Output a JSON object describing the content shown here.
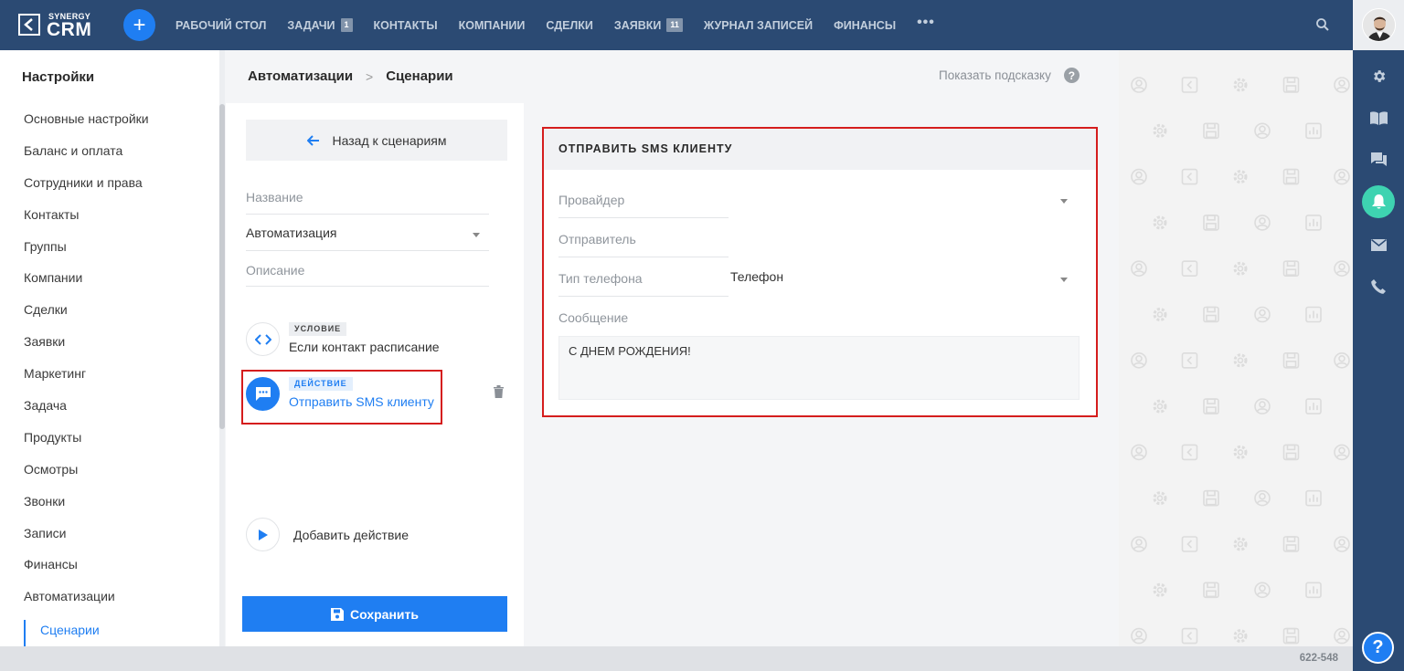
{
  "brand": {
    "logo_top": "SYNERGY",
    "logo_bottom": "CRM",
    "accent": "#1f7ef2",
    "header_bg": "#2b4a73"
  },
  "topnav": {
    "add_label": "+",
    "items": [
      {
        "label": "РАБОЧИЙ СТОЛ",
        "badge": ""
      },
      {
        "label": "ЗАДАЧИ",
        "badge": "1"
      },
      {
        "label": "КОНТАКТЫ",
        "badge": ""
      },
      {
        "label": "КОМПАНИИ",
        "badge": ""
      },
      {
        "label": "СДЕЛКИ",
        "badge": ""
      },
      {
        "label": "ЗАЯВКИ",
        "badge": "11"
      },
      {
        "label": "ЖУРНАЛ ЗАПИСЕЙ",
        "badge": ""
      },
      {
        "label": "ФИНАНСЫ",
        "badge": ""
      }
    ],
    "more": "•••"
  },
  "sidebar": {
    "title": "Настройки",
    "items": [
      "Основные настройки",
      "Баланс и оплата",
      "Сотрудники и права",
      "Контакты",
      "Группы",
      "Компании",
      "Сделки",
      "Заявки",
      "Маркетинг",
      "Задача",
      "Продукты",
      "Осмотры",
      "Звонки",
      "Записи",
      "Финансы",
      "Автоматизации"
    ],
    "active_sub": "Сценарии"
  },
  "breadcrumb": {
    "parent": "Автоматизации",
    "sep": ">",
    "current": "Сценарии"
  },
  "hint": {
    "label": "Показать подсказку",
    "icon_glyph": "?"
  },
  "scenario": {
    "back_label": "Назад к сценариям",
    "name_label": "Название",
    "name_value": "Автоматизация",
    "description_label": "Описание",
    "condition": {
      "tag": "УСЛОВИЕ",
      "text": "Если контакт расписание"
    },
    "action": {
      "tag": "ДЕЙСТВИЕ",
      "text": "Отправить SMS клиенту"
    },
    "add_action_label": "Добавить действие",
    "save_label": "Сохранить"
  },
  "form": {
    "title": "ОТПРАВИТЬ SMS КЛИЕНТУ",
    "provider_label": "Провайдер",
    "provider_value": "",
    "sender_label": "Отправитель",
    "phone_type_label": "Тип телефона",
    "phone_type_value": "Телефон",
    "message_label": "Сообщение",
    "message_value": "С ДНЕМ РОЖДЕНИЯ!"
  },
  "rail": {
    "icons": [
      "gear-icon",
      "book-icon",
      "chat-icon",
      "bell-icon",
      "mail-icon",
      "phone-icon"
    ],
    "help_glyph": "?"
  },
  "footer": {
    "version": "622-548"
  }
}
